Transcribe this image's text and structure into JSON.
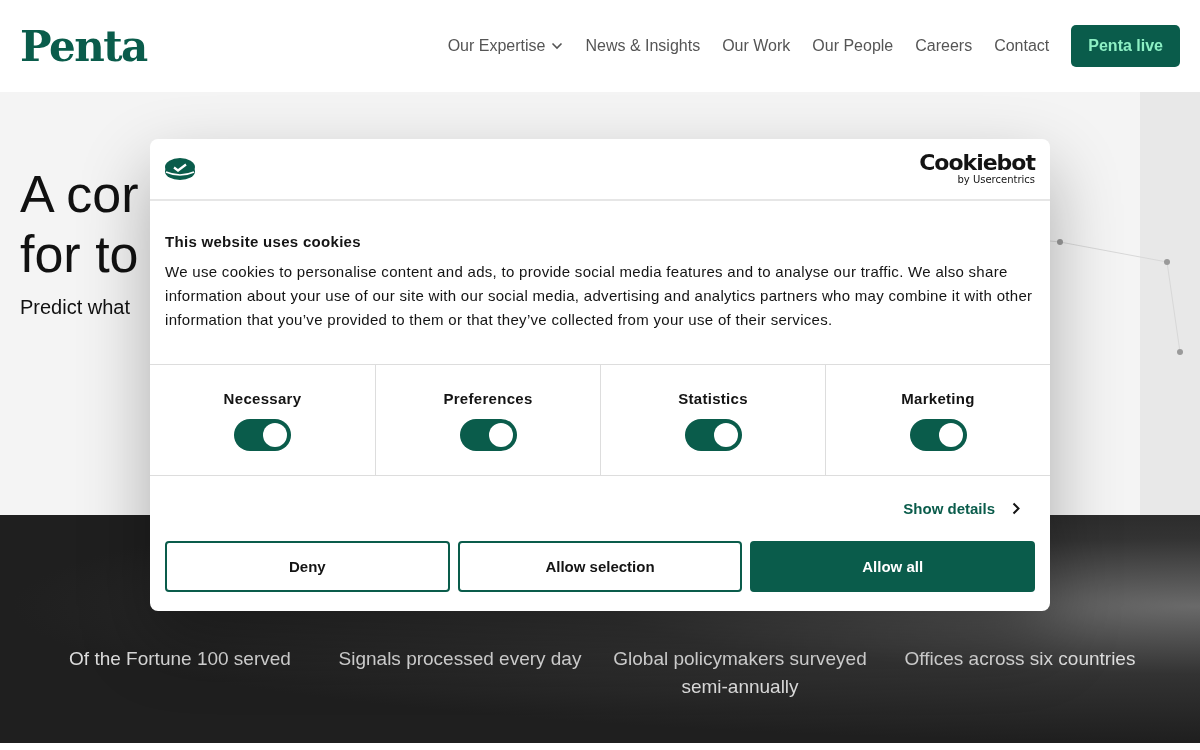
{
  "header": {
    "logo": "Penta",
    "nav": [
      {
        "label": "Our Expertise",
        "dropdown": true
      },
      {
        "label": "News & Insights",
        "dropdown": false
      },
      {
        "label": "Our Work",
        "dropdown": false
      },
      {
        "label": "Our People",
        "dropdown": false
      },
      {
        "label": "Careers",
        "dropdown": false
      },
      {
        "label": "Contact",
        "dropdown": false
      }
    ],
    "cta": "Penta live"
  },
  "hero": {
    "heading_lines": [
      "A cor",
      "for to"
    ],
    "subtitle": "Predict what"
  },
  "stats": [
    {
      "label": "Of the Fortune 100 served"
    },
    {
      "label": "Signals processed every day"
    },
    {
      "label": "Global policymakers surveyed semi-annually"
    },
    {
      "label": "Offices across six countries"
    }
  ],
  "cookie_dialog": {
    "brand": {
      "name": "Cookiebot",
      "byline": "by Usercentrics"
    },
    "title": "This website uses cookies",
    "body": "We use cookies to personalise content and ads, to provide social media features and to analyse our traffic. We also share information about your use of our site with our social media, advertising and analytics partners who may combine it with other information that you’ve provided to them or that they’ve collected from your use of their services.",
    "categories": [
      {
        "label": "Necessary",
        "checked": true
      },
      {
        "label": "Preferences",
        "checked": true
      },
      {
        "label": "Statistics",
        "checked": true
      },
      {
        "label": "Marketing",
        "checked": true
      }
    ],
    "details_link": "Show details",
    "buttons": [
      {
        "label": "Deny",
        "kind": "outline"
      },
      {
        "label": "Allow selection",
        "kind": "outline"
      },
      {
        "label": "Allow all",
        "kind": "filled"
      }
    ]
  }
}
